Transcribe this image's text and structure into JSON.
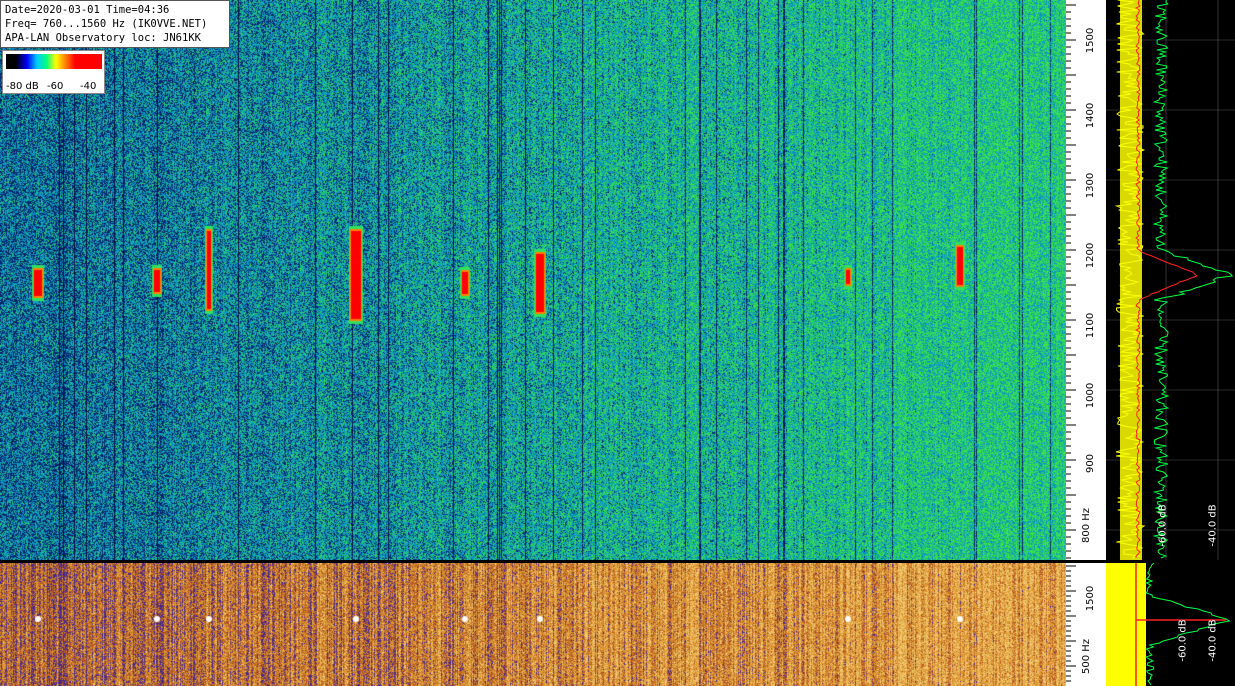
{
  "info": {
    "line1": "Date=2020-03-01 Time=04:36",
    "line2": "Freq= 760...1560 Hz (IK0VVE.NET)",
    "line3": "APA-LAN Observatory loc: JN61KK"
  },
  "legend": {
    "labels": [
      "-80 dB",
      "-60",
      "-40"
    ],
    "scale_colors": [
      "#000000",
      "#0000ff",
      "#00c8ff",
      "#00ff80",
      "#ffff00",
      "#ff8000",
      "#ff0000"
    ]
  },
  "freq_axis_top": {
    "ticks": [
      "1500",
      "1400",
      "1300",
      "1200",
      "1100",
      "1000",
      "900",
      "800 Hz"
    ],
    "range_hz": [
      760,
      1560
    ]
  },
  "freq_axis_bottom": {
    "ticks": [
      "1500",
      "500 Hz"
    ]
  },
  "spectrum_top": {
    "db_labels": [
      "-60.0 dB",
      "-40.0 dB"
    ],
    "peak_hz": 1175
  },
  "spectrum_bottom": {
    "db_labels": [
      "-60.0 dB",
      "-40.0 dB"
    ]
  },
  "colors": {
    "waterfall_bg": "#0a3d8a",
    "waterfall_green": "#30e060",
    "signal_red": "#ff0000",
    "bottom_orange": "#d89030",
    "bottom_purple": "#4a2a8a",
    "trace_yellow": "#ffff00",
    "trace_green": "#00ff40",
    "trace_red": "#ff2020"
  }
}
